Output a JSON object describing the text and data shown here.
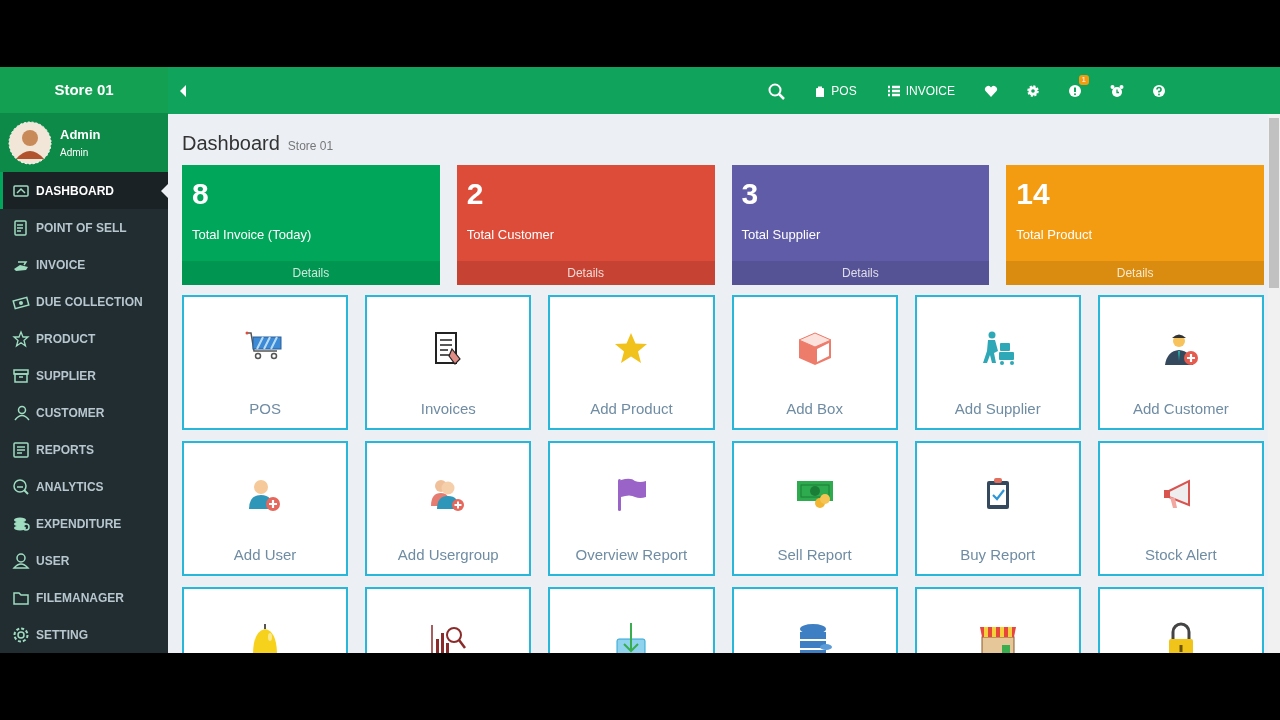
{
  "sidebar": {
    "brand": "Store 01",
    "user": {
      "name": "Admin",
      "role": "Admin"
    },
    "items": [
      {
        "label": "DASHBOARD",
        "selected": true
      },
      {
        "label": "POINT OF SELL",
        "selected": false
      },
      {
        "label": "INVOICE",
        "selected": false
      },
      {
        "label": "DUE COLLECTION",
        "selected": false
      },
      {
        "label": "PRODUCT",
        "selected": false
      },
      {
        "label": "SUPPLIER",
        "selected": false
      },
      {
        "label": "CUSTOMER",
        "selected": false
      },
      {
        "label": "REPORTS",
        "selected": false
      },
      {
        "label": "ANALYTICS",
        "selected": false
      },
      {
        "label": "EXPENDITURE",
        "selected": false
      },
      {
        "label": "USER",
        "selected": false
      },
      {
        "label": "FILEMANAGER",
        "selected": false
      },
      {
        "label": "SETTING",
        "selected": false
      }
    ]
  },
  "topbar": {
    "items": [
      {
        "kind": "icon"
      },
      {
        "kind": "link",
        "label": "POS"
      },
      {
        "kind": "link",
        "label": "INVOICE"
      },
      {
        "kind": "icon"
      },
      {
        "kind": "icon"
      },
      {
        "kind": "icon",
        "badge": "1"
      },
      {
        "kind": "icon"
      },
      {
        "kind": "icon"
      }
    ]
  },
  "page_header": {
    "title": "Dashboard",
    "subtitle": "Store 01"
  },
  "stats": [
    {
      "value": "8",
      "label": "Total Invoice (Today)",
      "footer": "Details",
      "color": "#00a65a"
    },
    {
      "value": "2",
      "label": "Total Customer",
      "footer": "Details",
      "color": "#dd4b39"
    },
    {
      "value": "3",
      "label": "Total Supplier",
      "footer": "Details",
      "color": "#605ca8"
    },
    {
      "value": "14",
      "label": "Total Product",
      "footer": "Details",
      "color": "#f39c12"
    }
  ],
  "tiles": [
    {
      "kind": "shortcut",
      "label": "POS"
    },
    {
      "kind": "shortcut",
      "label": "Invoices"
    },
    {
      "kind": "shortcut",
      "label": "Add Product"
    },
    {
      "kind": "shortcut",
      "label": "Add Box"
    },
    {
      "kind": "shortcut",
      "label": "Add Supplier"
    },
    {
      "kind": "shortcut",
      "label": "Add Customer"
    },
    {
      "kind": "shortcut",
      "label": "Add User"
    },
    {
      "kind": "shortcut",
      "label": "Add Usergroup"
    },
    {
      "kind": "shortcut",
      "label": "Overview Report"
    },
    {
      "kind": "shortcut",
      "label": "Sell Report"
    },
    {
      "kind": "shortcut",
      "label": "Buy Report"
    },
    {
      "kind": "shortcut",
      "label": "Stock Alert"
    },
    {
      "kind": "shortcut"
    },
    {
      "kind": "shortcut"
    },
    {
      "kind": "shortcut"
    },
    {
      "kind": "shortcut"
    },
    {
      "kind": "shortcut"
    },
    {
      "kind": "shortcut"
    }
  ]
}
